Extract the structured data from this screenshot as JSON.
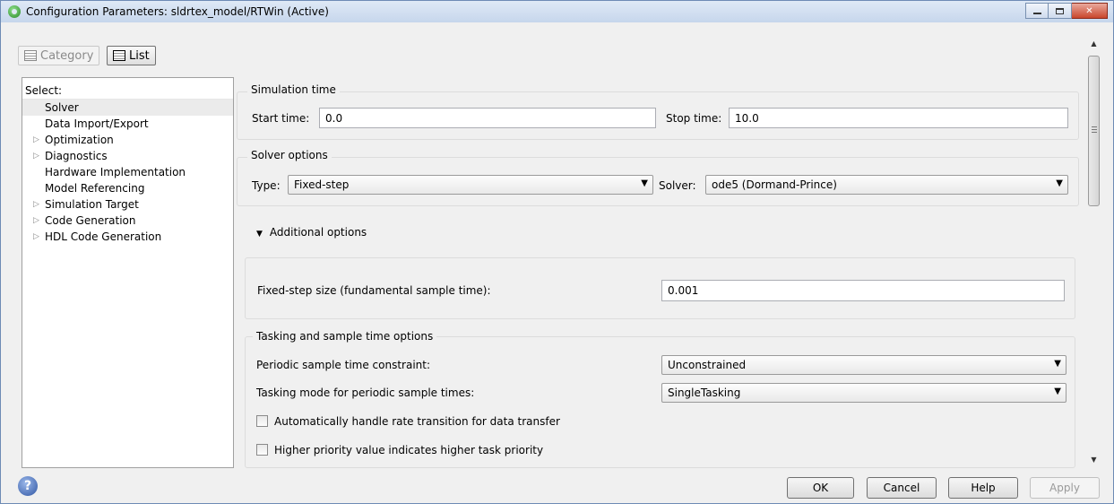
{
  "window": {
    "title": "Configuration Parameters: sldrtex_model/RTWin (Active)"
  },
  "view_toggle": {
    "category_label": "Category",
    "list_label": "List"
  },
  "tree": {
    "header": "Select:",
    "items": [
      {
        "label": "Solver",
        "expandable": false,
        "selected": true
      },
      {
        "label": "Data Import/Export",
        "expandable": false
      },
      {
        "label": "Optimization",
        "expandable": true
      },
      {
        "label": "Diagnostics",
        "expandable": true
      },
      {
        "label": "Hardware Implementation",
        "expandable": false
      },
      {
        "label": "Model Referencing",
        "expandable": false
      },
      {
        "label": "Simulation Target",
        "expandable": true
      },
      {
        "label": "Code Generation",
        "expandable": true
      },
      {
        "label": "HDL Code Generation",
        "expandable": true
      }
    ]
  },
  "simulation_time": {
    "title": "Simulation time",
    "start_label": "Start time:",
    "start_value": "0.0",
    "stop_label": "Stop time:",
    "stop_value": "10.0"
  },
  "solver_options": {
    "title": "Solver options",
    "type_label": "Type:",
    "type_value": "Fixed-step",
    "solver_label": "Solver:",
    "solver_value": "ode5 (Dormand-Prince)"
  },
  "additional_options": {
    "label": "Additional options",
    "fixed_step_label": "Fixed-step size (fundamental sample time):",
    "fixed_step_value": "0.001"
  },
  "tasking": {
    "title": "Tasking and sample time options",
    "periodic_label": "Periodic sample time constraint:",
    "periodic_value": "Unconstrained",
    "mode_label": "Tasking mode for periodic sample times:",
    "mode_value": "SingleTasking",
    "auto_rate_label": "Automatically handle rate transition for data transfer",
    "auto_rate_checked": false,
    "priority_label": "Higher priority value indicates higher task priority",
    "priority_checked": false
  },
  "buttons": {
    "ok": "OK",
    "cancel": "Cancel",
    "help": "Help",
    "apply": "Apply"
  },
  "icons": {
    "app": "matlab-config-icon",
    "help": "help-circle-icon",
    "minimize": "minimize-icon",
    "maximize": "maximize-icon",
    "close": "close-icon"
  },
  "colors": {
    "close_button": "#c9462c",
    "titlebar": "#c6d6ec"
  }
}
